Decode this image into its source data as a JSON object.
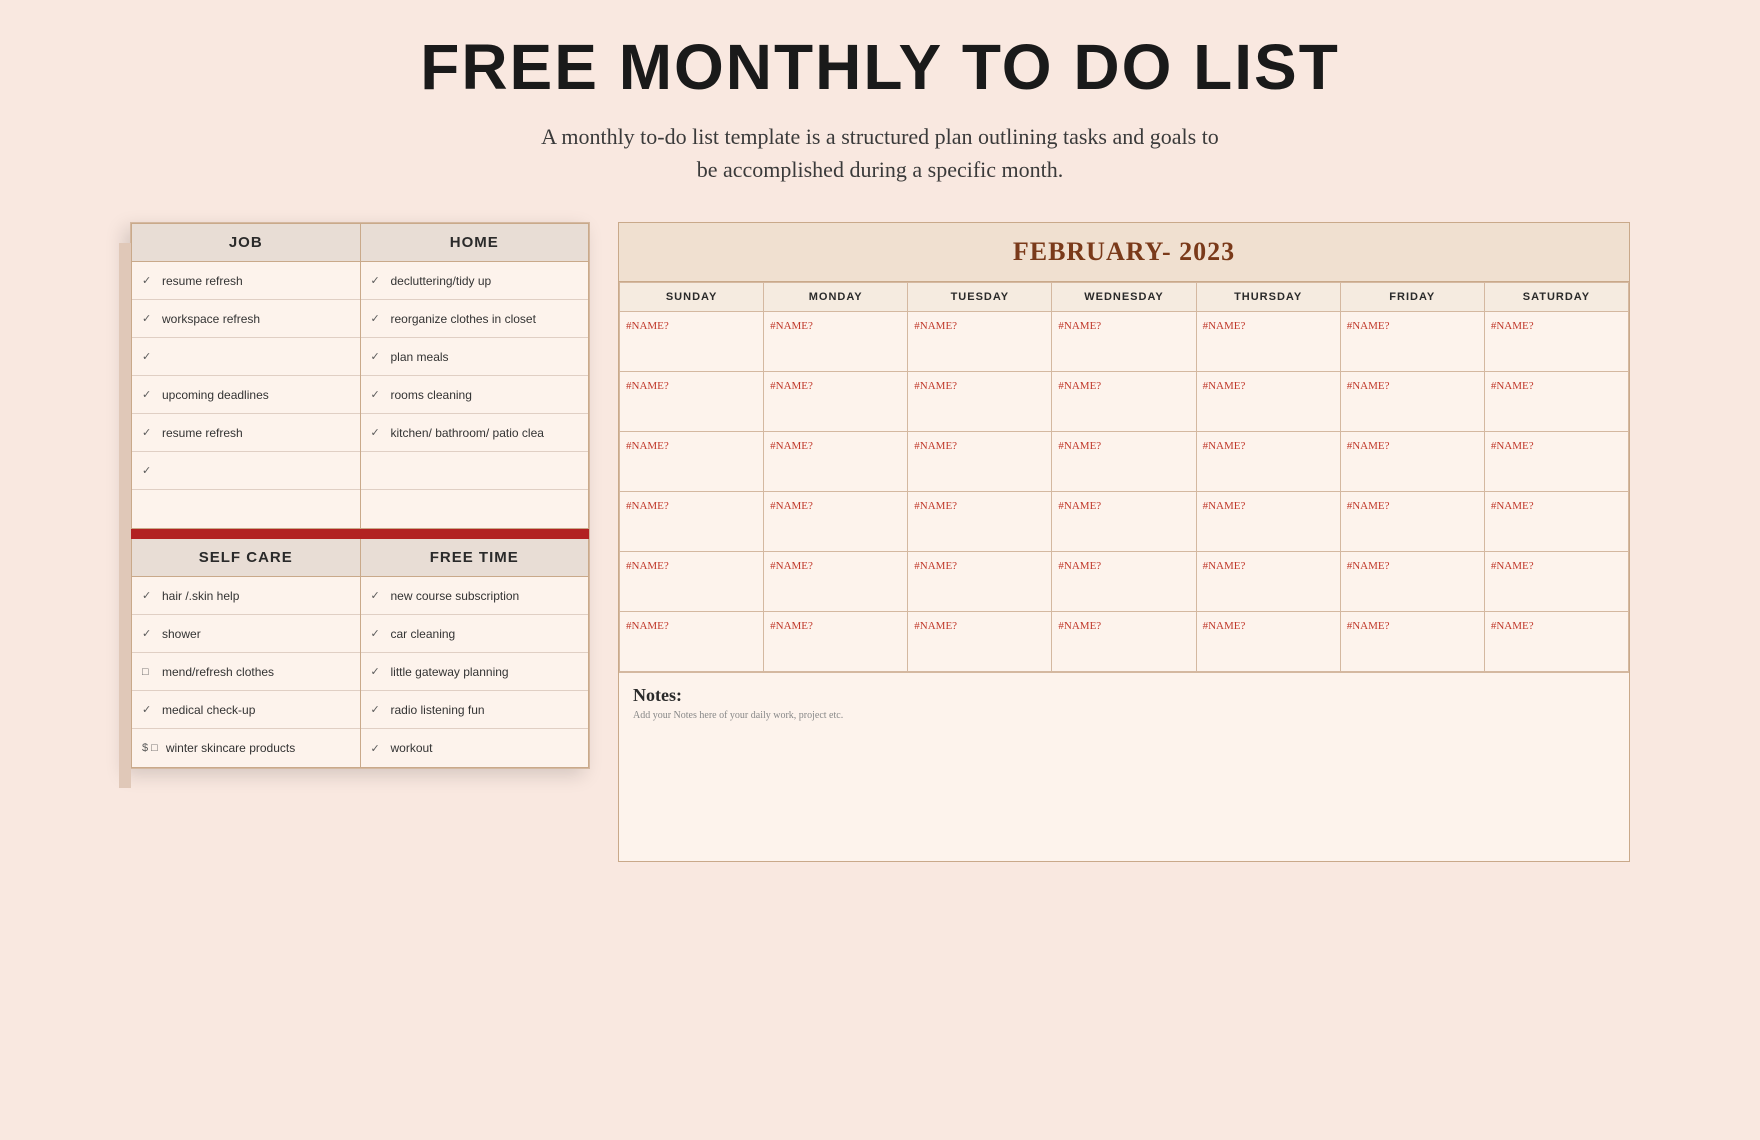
{
  "header": {
    "title": "FREE MONTHLY TO DO LIST",
    "subtitle": "A monthly to-do list template is a structured plan outlining tasks and goals to be accomplished during a specific month."
  },
  "todo": {
    "job_header": "JOB",
    "home_header": "HOME",
    "selfcare_header": "SELF CARE",
    "freetime_header": "FREE TIME",
    "job_items": [
      {
        "check": "✓",
        "text": "resume refresh"
      },
      {
        "check": "✓",
        "text": "workspace refresh"
      },
      {
        "check": "✓",
        "text": ""
      },
      {
        "check": "✓",
        "text": "upcoming deadlines"
      },
      {
        "check": "✓",
        "text": "resume refresh"
      },
      {
        "check": "✓",
        "text": ""
      },
      {
        "check": "",
        "text": ""
      }
    ],
    "home_items": [
      {
        "check": "✓",
        "text": "decluttering/tidy up"
      },
      {
        "check": "✓",
        "text": "reorganize clothes in closet"
      },
      {
        "check": "✓",
        "text": "plan meals"
      },
      {
        "check": "✓",
        "text": "rooms cleaning"
      },
      {
        "check": "✓",
        "text": "kitchen/ bathroom/ patio clea"
      },
      {
        "check": "",
        "text": ""
      },
      {
        "check": "",
        "text": ""
      }
    ],
    "selfcare_items": [
      {
        "check": "✓",
        "text": "hair /.skin help"
      },
      {
        "check": "✓",
        "text": "shower"
      },
      {
        "check": "□",
        "text": "mend/refresh clothes"
      },
      {
        "check": "✓",
        "text": "medical check-up"
      },
      {
        "check": "$  □",
        "text": "winter skincare products"
      }
    ],
    "freetime_items": [
      {
        "check": "✓",
        "text": "new course subscription"
      },
      {
        "check": "✓",
        "text": "car cleaning"
      },
      {
        "check": "✓",
        "text": "little gateway planning"
      },
      {
        "check": "✓",
        "text": "radio listening fun"
      },
      {
        "check": "✓",
        "text": "workout"
      }
    ]
  },
  "calendar": {
    "title": "FEBRUARY- 2023",
    "days": [
      "SUNDAY",
      "MONDAY",
      "TUESDAY",
      "WEDNESDAY",
      "THURSDAY",
      "FRIDAY",
      "SATURDAY"
    ],
    "rows": [
      [
        "#NAME?",
        "#NAME?",
        "#NAME?",
        "#NAME?",
        "#NAME?",
        "#NAME?",
        "#NAME?"
      ],
      [
        "#NAME?",
        "#NAME?",
        "#NAME?",
        "#NAME?",
        "#NAME?",
        "#NAME?",
        "#NAME?"
      ],
      [
        "#NAME?",
        "#NAME?",
        "#NAME?",
        "#NAME?",
        "#NAME?",
        "#NAME?",
        "#NAME?"
      ],
      [
        "#NAME?",
        "#NAME?",
        "#NAME?",
        "#NAME?",
        "#NAME?",
        "#NAME?",
        "#NAME?"
      ],
      [
        "#NAME?",
        "#NAME?",
        "#NAME?",
        "#NAME?",
        "#NAME?",
        "#NAME?",
        "#NAME?"
      ],
      [
        "#NAME?",
        "#NAME?",
        "#NAME?",
        "#NAME?",
        "#NAME?",
        "#NAME?",
        "#NAME?"
      ]
    ],
    "notes_title": "Notes:",
    "notes_subtitle": "Add your Notes here of your daily work, project etc."
  }
}
